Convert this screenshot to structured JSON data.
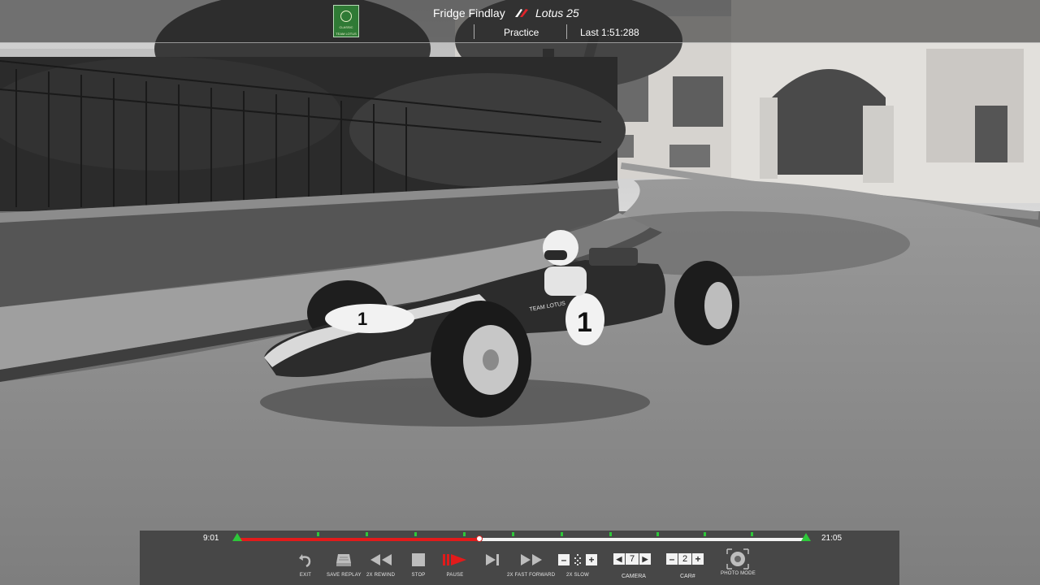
{
  "header": {
    "driver_name": "Fridge Findlay",
    "car_name": "Lotus 25",
    "session": "Practice",
    "last_lap": "Last 1:51:288",
    "team_badge": {
      "line1": "CLASSIC",
      "line2": "TEAM LOTUS",
      "color": "#2f7a35"
    },
    "brand_icon": "red-white-brand-logo-icon"
  },
  "car_livery": {
    "number": "1",
    "side_text": "TEAM LOTUS"
  },
  "replay": {
    "time_start": "9:01",
    "time_end": "21:05",
    "progress": 0.425,
    "played_color": "#e21b1b",
    "marker_color": "#2ec73a",
    "controls": [
      {
        "id": "exit",
        "label": "EXIT",
        "icon": "undo-arrow-icon"
      },
      {
        "id": "save",
        "label": "SAVE REPLAY",
        "icon": "save-tray-icon"
      },
      {
        "id": "rewind",
        "label": "2X REWIND",
        "icon": "rewind-icon"
      },
      {
        "id": "stop",
        "label": "STOP",
        "icon": "stop-icon"
      },
      {
        "id": "pause",
        "label": "PAUSE",
        "icon": "play-icon"
      },
      {
        "id": "step",
        "label": "",
        "icon": "step-forward-icon"
      },
      {
        "id": "ffwd",
        "label": "2X FAST FORWARD",
        "icon": "fast-forward-icon"
      },
      {
        "id": "slow",
        "label": "2X SLOW",
        "icon": "slow-motion-icon"
      },
      {
        "id": "photo",
        "label": "PHOTO MODE",
        "icon": "camera-aperture-icon"
      }
    ],
    "camera": {
      "label": "CAMERA",
      "value": "7"
    },
    "car": {
      "label": "CAR#",
      "value": "2"
    }
  }
}
